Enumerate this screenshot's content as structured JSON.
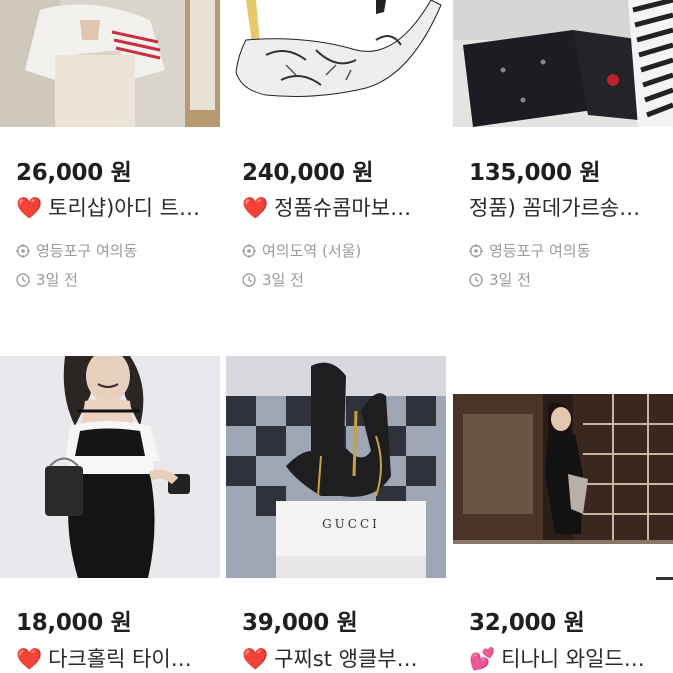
{
  "listings": [
    {
      "price": "26,000 원",
      "title": "토리샵)아디 트…",
      "heart": "❤️",
      "location": "영등포구 여의동",
      "time": "3일 전"
    },
    {
      "price": "240,000 원",
      "title": "정품슈콤마보…",
      "heart": "❤️",
      "location": "여의도역 (서울)",
      "time": "3일 전"
    },
    {
      "price": "135,000 원",
      "title": "정품) 꼼데가르송…",
      "heart": "",
      "location": "영등포구 여의동",
      "time": "3일 전"
    },
    {
      "price": "18,000 원",
      "title": "다크홀릭 타이…",
      "heart": "❤️",
      "location": "",
      "time": ""
    },
    {
      "price": "39,000 원",
      "title": "구찌st 앵클부…",
      "heart": "❤️",
      "location": "",
      "time": ""
    },
    {
      "price": "32,000 원",
      "title": "티나니 와일드…",
      "heart": "💕",
      "location": "",
      "time": ""
    }
  ],
  "boxLabel": "GUCCI",
  "icons": {
    "location": "location-target-icon",
    "time": "clock-icon"
  },
  "colors": {
    "heart": "#e53935",
    "meta": "#9a9a9a",
    "price": "#1f1f1f"
  }
}
